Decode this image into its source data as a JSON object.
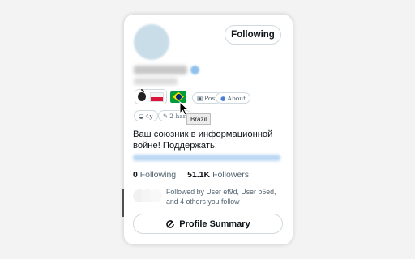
{
  "follow_button": {
    "label": "Following"
  },
  "badges": {
    "post": "Post",
    "about": "About",
    "account_age": "4y",
    "handle_changes": "2 han"
  },
  "tooltip": {
    "text": "Brazil"
  },
  "bio": {
    "line1": "Ваш союзник в информационной",
    "line2": "войне! Поддержать:"
  },
  "stats": {
    "following_count": "0",
    "following_label": "Following",
    "followers_count": "51.1K",
    "followers_label": "Followers"
  },
  "followed_by": {
    "text": "Followed by User ef9d, User b5ed, and 4 others you follow"
  },
  "summary_button": {
    "label": "Profile Summary"
  },
  "icons": {
    "os": "apple-icon",
    "country_flags": [
      "poland-flag-icon",
      "brazil-flag-icon"
    ]
  }
}
